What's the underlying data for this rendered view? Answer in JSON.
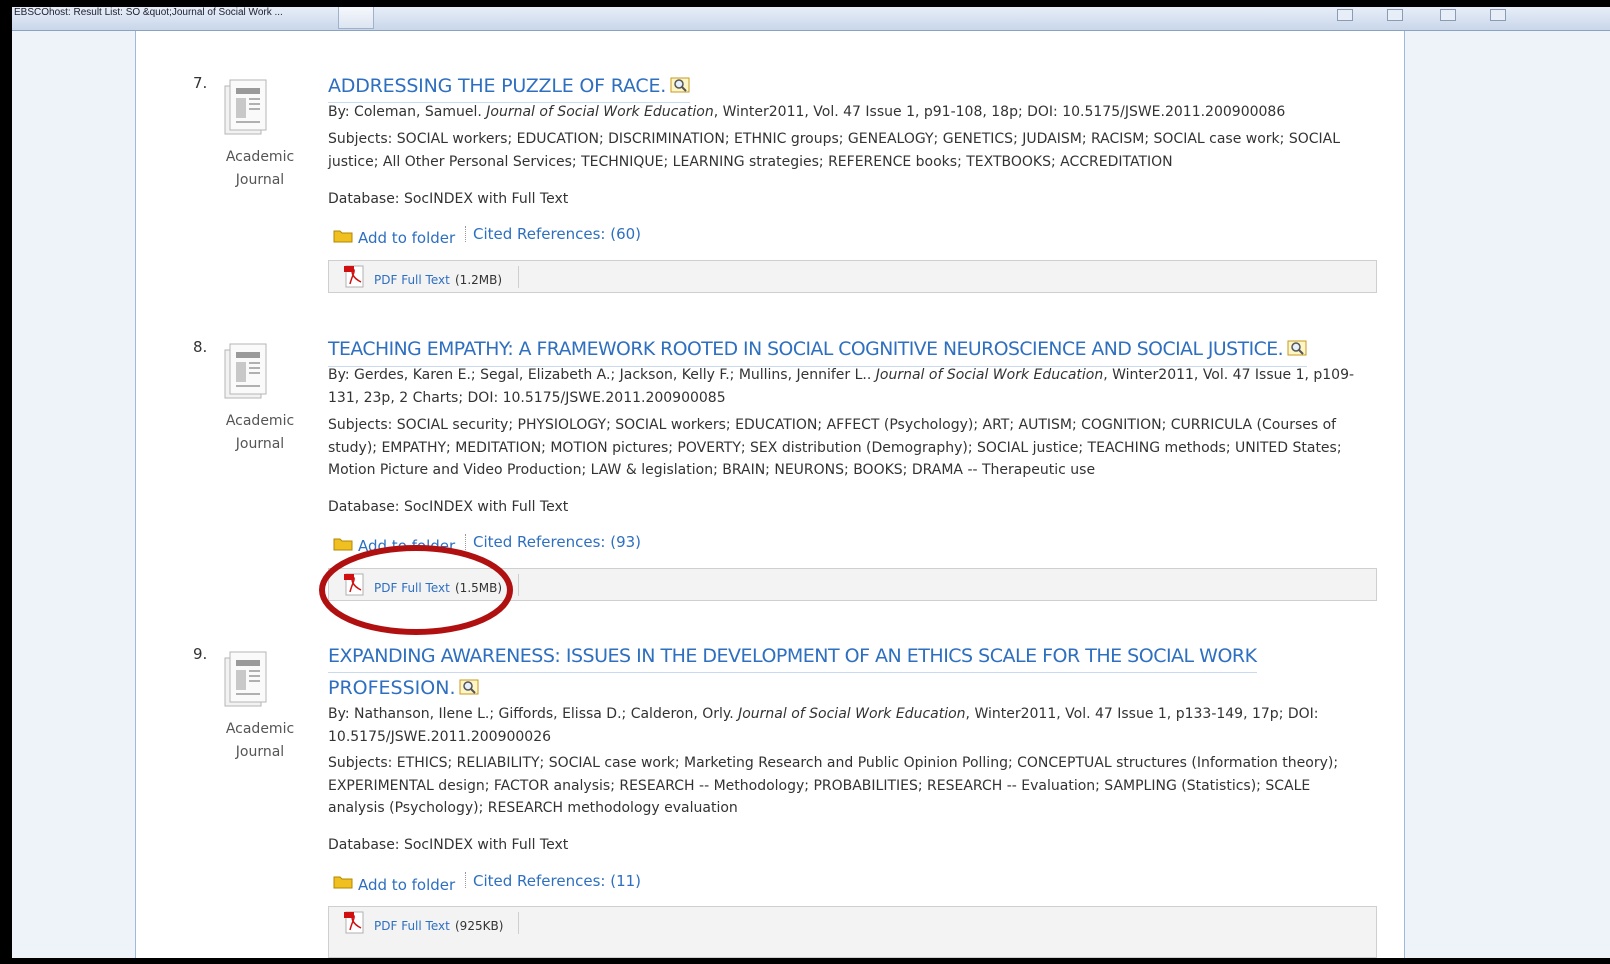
{
  "browser": {
    "tab_title": "EBSCOhost: Result List: SO &quot;Journal of Social Work ..."
  },
  "common": {
    "database": "Database: SocINDEX with Full Text",
    "add_to_folder": "Add to folder",
    "pdf_full_text": "PDF Full Text"
  },
  "results": [
    {
      "number": "7.",
      "type_line1": "Academic",
      "type_line2": "Journal",
      "title": "ADDRESSING THE PUZZLE OF RACE.",
      "by_prefix": "By: Coleman, Samuel. ",
      "journal": "Journal of Social Work Education",
      "by_suffix": ", Winter2011, Vol. 47 Issue 1, p91-108, 18p; DOI: 10.5175/JSWE.2011.200900086",
      "subjects": "Subjects: SOCIAL workers; EDUCATION; DISCRIMINATION; ETHNIC groups; GENEALOGY; GENETICS; JUDAISM; RACISM; SOCIAL case work; SOCIAL justice; All Other Personal Services; TECHNIQUE; LEARNING strategies; REFERENCE books; TEXTBOOKS; ACCREDITATION",
      "cited": "Cited References: (60)",
      "pdf_size": "(1.2MB)"
    },
    {
      "number": "8.",
      "type_line1": "Academic",
      "type_line2": "Journal",
      "title": "TEACHING EMPATHY: A FRAMEWORK ROOTED IN SOCIAL COGNITIVE NEUROSCIENCE AND SOCIAL JUSTICE.",
      "by_prefix": "By: Gerdes, Karen E.; Segal, Elizabeth A.; Jackson, Kelly F.; Mullins, Jennifer L.. ",
      "journal": "Journal of Social Work Education",
      "by_suffix": ", Winter2011, Vol. 47 Issue 1, p109-131, 23p, 2 Charts; DOI: 10.5175/JSWE.2011.200900085",
      "subjects": "Subjects: SOCIAL security; PHYSIOLOGY; SOCIAL workers; EDUCATION; AFFECT (Psychology); ART; AUTISM; COGNITION; CURRICULA (Courses of study); EMPATHY; MEDITATION; MOTION pictures; POVERTY; SEX distribution (Demography); SOCIAL justice; TEACHING methods; UNITED States; Motion Picture and Video Production; LAW & legislation; BRAIN; NEURONS; BOOKS; DRAMA -- Therapeutic use",
      "cited": "Cited References: (93)",
      "pdf_size": "(1.5MB)"
    },
    {
      "number": "9.",
      "type_line1": "Academic",
      "type_line2": "Journal",
      "title_line1": "EXPANDING AWARENESS: ISSUES IN THE DEVELOPMENT OF AN ETHICS SCALE FOR THE SOCIAL WORK",
      "title_line2": "PROFESSION.",
      "by_prefix": "By: Nathanson, Ilene L.; Giffords, Elissa D.; Calderon, Orly. ",
      "journal": "Journal of Social Work Education",
      "by_suffix": ", Winter2011, Vol. 47 Issue 1, p133-149, 17p; DOI: 10.5175/JSWE.2011.200900026",
      "subjects": "Subjects: ETHICS; RELIABILITY; SOCIAL case work; Marketing Research and Public Opinion Polling; CONCEPTUAL structures (Information theory); EXPERIMENTAL design; FACTOR analysis; RESEARCH -- Methodology; PROBABILITIES; RESEARCH -- Evaluation; SAMPLING (Statistics); SCALE analysis (Psychology); RESEARCH methodology evaluation",
      "cited": "Cited References: (11)",
      "pdf_size": "(925KB)"
    }
  ],
  "colors": {
    "link": "#2e6fc0",
    "highlight": "#b01010"
  }
}
